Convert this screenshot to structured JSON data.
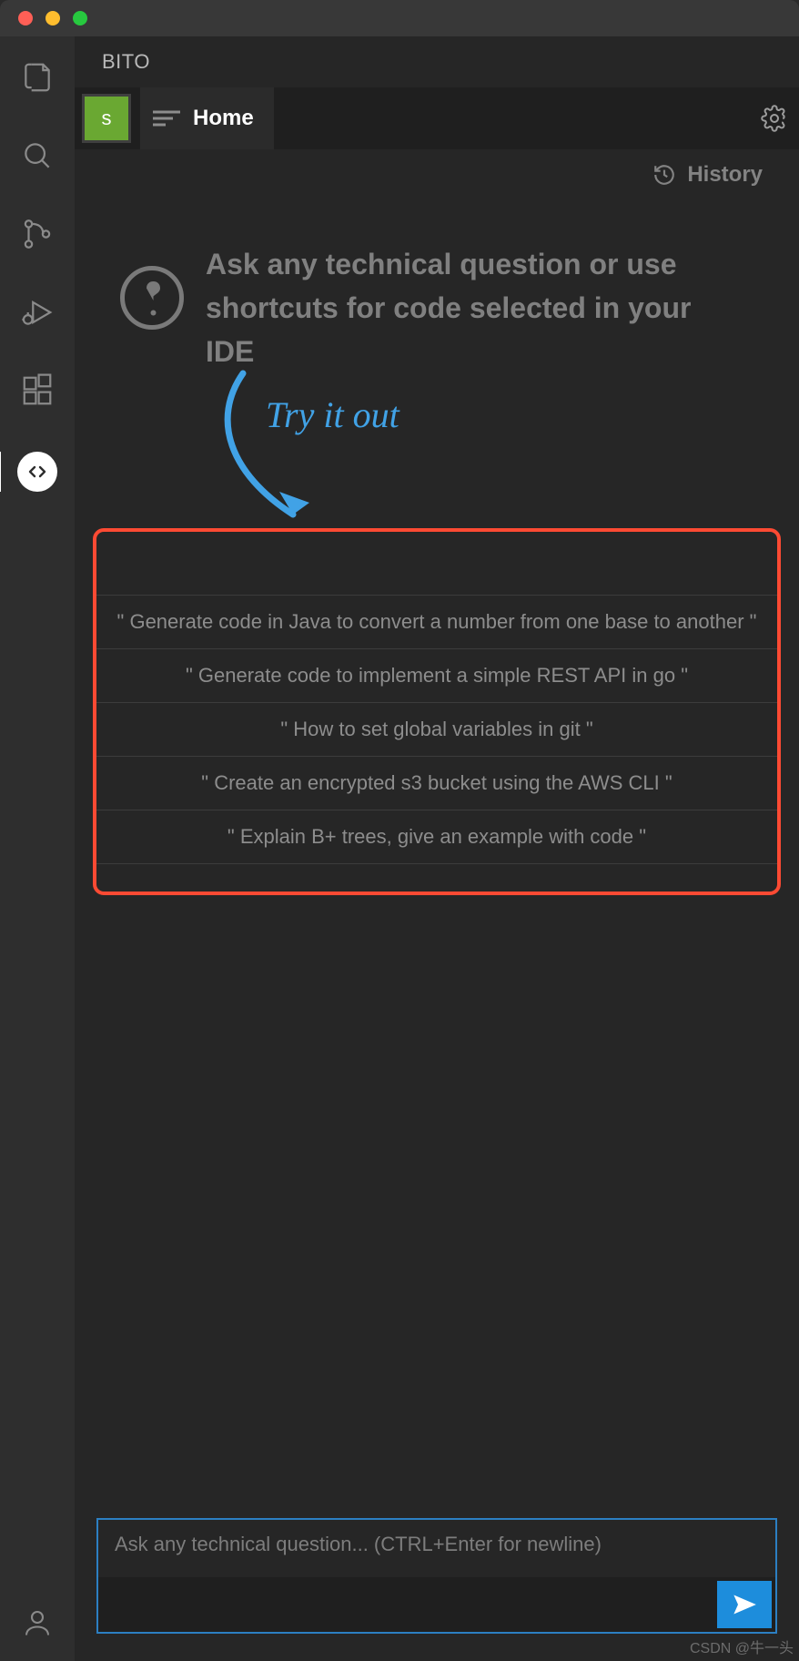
{
  "panel": {
    "title": "BITO"
  },
  "avatar": {
    "letter": "s"
  },
  "tabs": {
    "home_label": "Home"
  },
  "history": {
    "label": "History"
  },
  "hero": {
    "text": "Ask any technical question or use shortcuts for code selected in your IDE"
  },
  "try": {
    "label": "Try it out"
  },
  "suggestions": [
    "\" Generate code in Java to convert a number from one base to another \"",
    "\" Generate code to implement a simple REST API in go \"",
    "\" How to set global variables in git \"",
    "\" Create an encrypted s3 bucket using the AWS CLI \"",
    "\" Explain B+ trees, give an example with code \""
  ],
  "input": {
    "placeholder": "Ask any technical question... (CTRL+Enter for newline)"
  },
  "watermark": "CSDN @牛一头"
}
